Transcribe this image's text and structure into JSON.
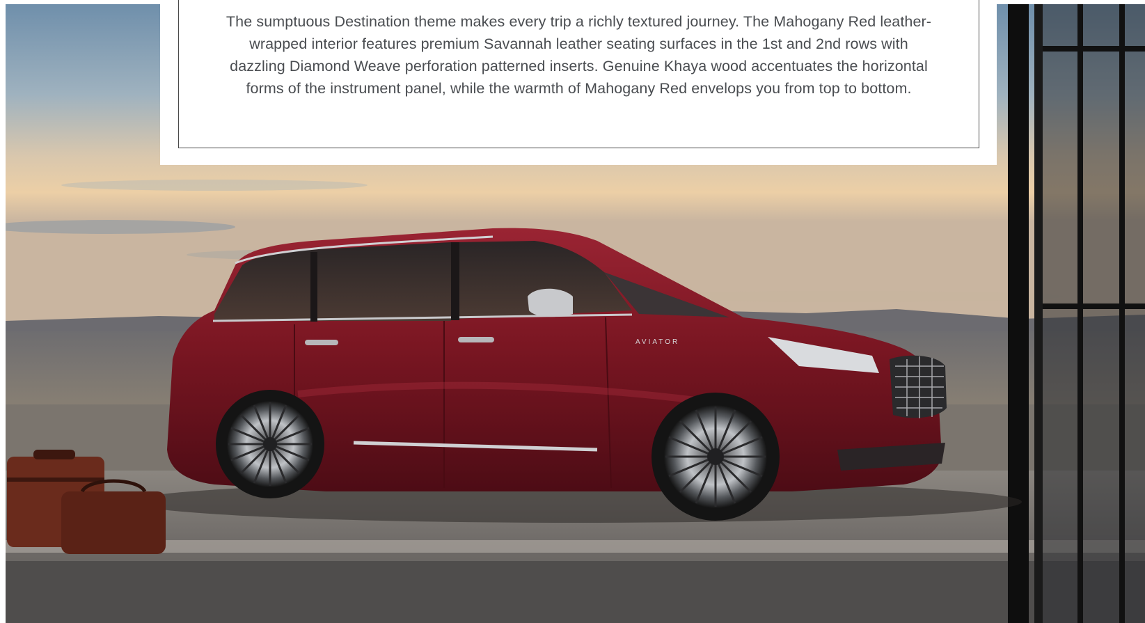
{
  "caption": {
    "text": "The sumptuous Destination theme makes every trip a richly textured journey. The Mahogany Red leather-wrapped interior features premium Savannah leather seating surfaces in the 1st and 2nd rows with dazzling Diamond Weave perforation patterned inserts. Genuine Khaya wood accentuates the horizontal forms of the instrument panel, while the warmth of Mahogany Red envelops you from top to bottom."
  },
  "photo": {
    "badge_text": "AVIATOR",
    "colors": {
      "vehicle_body": "#7a1622",
      "sky_top": "#7b9bb5",
      "sky_horizon": "#e8c9a2",
      "ground": "#6f6a66",
      "luggage": "#6a2b1c"
    }
  }
}
